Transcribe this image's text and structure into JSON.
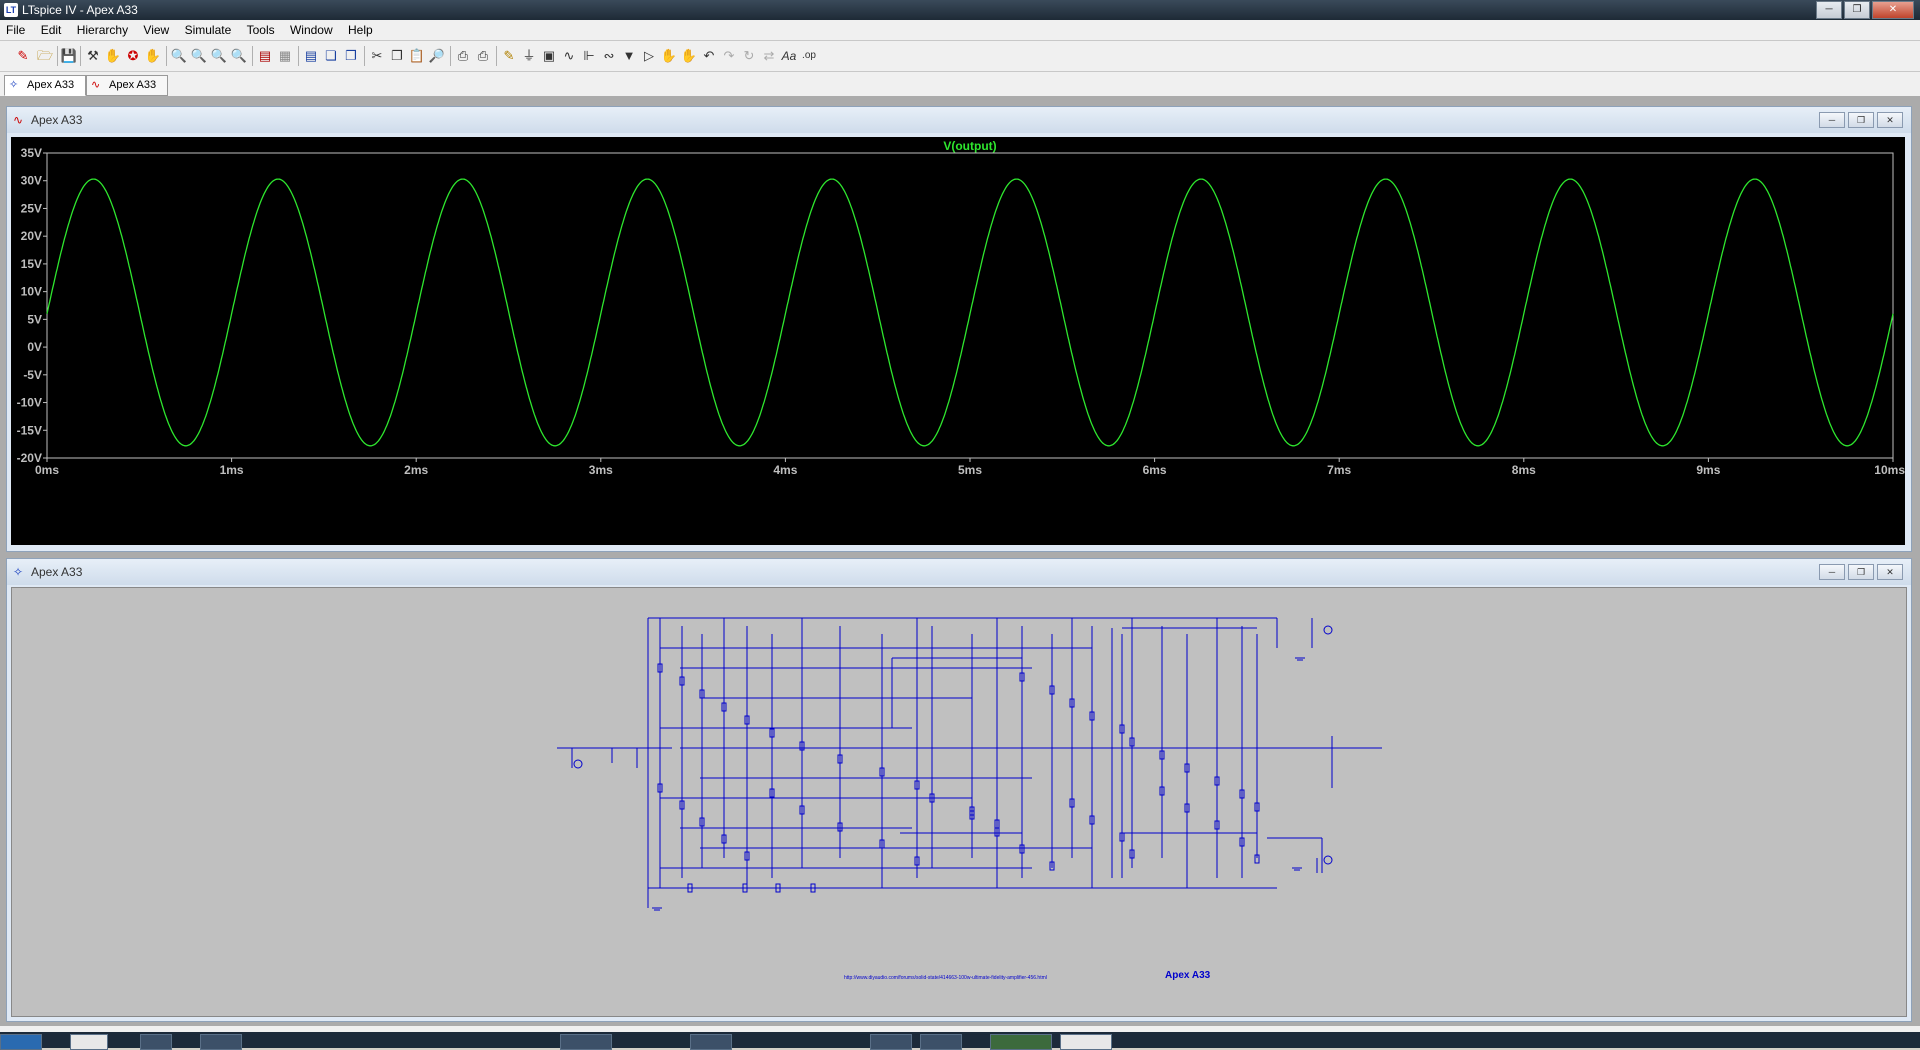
{
  "window": {
    "title": "LTspice IV - Apex A33",
    "icon": "ltspice-icon"
  },
  "menu": [
    "File",
    "Edit",
    "Hierarchy",
    "View",
    "Simulate",
    "Tools",
    "Window",
    "Help"
  ],
  "tabs": [
    {
      "label": "Apex A33",
      "icon": "schematic-icon"
    },
    {
      "label": "Apex A33",
      "icon": "waveform-icon"
    }
  ],
  "waveform_window": {
    "title": "Apex A33",
    "icon": "waveform-icon"
  },
  "schematic_window": {
    "title": "Apex A33",
    "icon": "schematic-icon"
  },
  "schematic": {
    "title": "Apex A33",
    "url": "http://www.diyaudio.com/forums/solid-state/414663-100w-ultimate-fidelity-amplifier-456.html"
  },
  "colors": {
    "trace": "#2ee62e",
    "wire": "#0000cc",
    "plot_bg": "#000000",
    "schematic_bg": "#c0c0c0"
  },
  "chart_data": {
    "type": "line",
    "title": "V(output)",
    "xlabel": "",
    "ylabel": "",
    "xlim": [
      0,
      10
    ],
    "ylim": [
      -20,
      35
    ],
    "x_unit": "ms",
    "y_unit": "V",
    "xticks": [
      "0ms",
      "1ms",
      "2ms",
      "3ms",
      "4ms",
      "5ms",
      "6ms",
      "7ms",
      "8ms",
      "9ms",
      "10ms"
    ],
    "yticks": [
      "35V",
      "30V",
      "25V",
      "20V",
      "15V",
      "10V",
      "5V",
      "0V",
      "-5V",
      "-10V",
      "-15V",
      "-20V"
    ],
    "grid": false,
    "series": [
      {
        "name": "V(output)",
        "waveform": "sine",
        "frequency_khz": 1,
        "max_v": 30.3,
        "min_v": -17.8,
        "offset_v": 6.25,
        "start_v": 6.0,
        "end_v": 5.5
      }
    ]
  }
}
